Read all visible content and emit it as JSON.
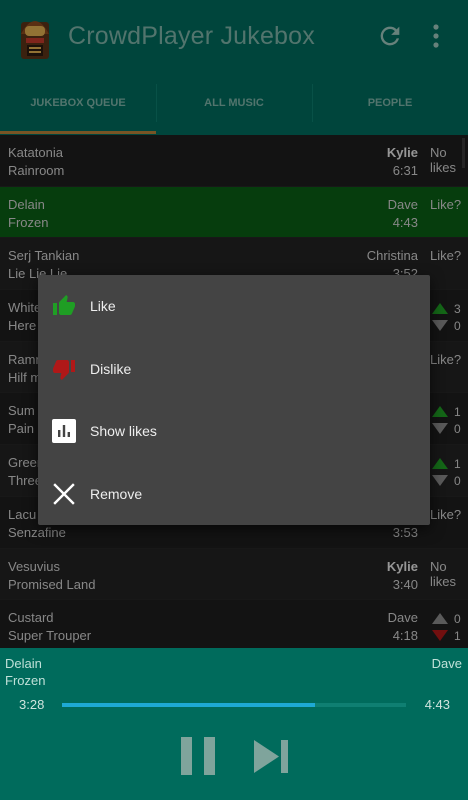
{
  "app": {
    "title": "CrowdPlayer Jukebox"
  },
  "tabs": [
    {
      "label": "JUKEBOX QUEUE"
    },
    {
      "label": "ALL MUSIC"
    },
    {
      "label": "PEOPLE"
    }
  ],
  "queue": [
    {
      "artist": "Katatonia",
      "song": "Rainroom",
      "user": "Kylie",
      "duration": "6:31",
      "likes_text": "No likes"
    },
    {
      "artist": "Delain",
      "song": "Frozen",
      "user": "Dave",
      "duration": "4:43",
      "likes_text": "Like?"
    },
    {
      "artist": "Serj Tankian",
      "song": "Lie Lie Lie",
      "user": "Christina",
      "duration": "3:52",
      "likes_text": "Like?"
    },
    {
      "artist": "White",
      "song": "Here",
      "user": "",
      "duration": "",
      "up": "3",
      "down": "0"
    },
    {
      "artist": "Ramm",
      "song": "Hilf m",
      "user": "",
      "duration": "",
      "likes_text": "Like?"
    },
    {
      "artist": "Sum",
      "song": "Pain",
      "user": "",
      "duration": "",
      "up": "1",
      "down": "0"
    },
    {
      "artist": "Green",
      "song": "Three",
      "user": "",
      "duration": "",
      "up": "1",
      "down": "0"
    },
    {
      "artist": "Lacu",
      "song": "Senzafine",
      "user": "",
      "duration": "3:53",
      "likes_text": "Like?"
    },
    {
      "artist": "Vesuvius",
      "song": "Promised Land",
      "user": "Kylie",
      "duration": "3:40",
      "likes_text": "No likes"
    },
    {
      "artist": "Custard",
      "song": "Super Trouper",
      "user": "Dave",
      "duration": "4:18",
      "up": "0",
      "down": "1"
    }
  ],
  "context_menu": {
    "items": [
      {
        "label": "Like",
        "icon": "thumbs-up-icon"
      },
      {
        "label": "Dislike",
        "icon": "thumbs-down-icon"
      },
      {
        "label": "Show likes",
        "icon": "bar-chart-icon"
      },
      {
        "label": "Remove",
        "icon": "close-icon"
      }
    ]
  },
  "player": {
    "artist": "Delain",
    "song": "Frozen",
    "user": "Dave",
    "elapsed": "3:28",
    "total": "4:43",
    "progress": 0.735
  },
  "colors": {
    "appbar": "#006b5c",
    "tab_indicator": "#b8823a",
    "playing_row": "#0a5f14",
    "progress_fill": "#1ea9d4",
    "like_green": "#1f9e24",
    "dislike_red": "#b01818"
  }
}
